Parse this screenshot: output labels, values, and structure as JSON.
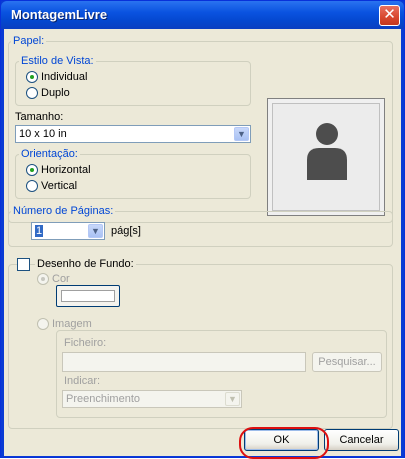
{
  "window": {
    "title": "MontagemLivre"
  },
  "papel": {
    "legend": "Papel:",
    "estilo": {
      "legend": "Estilo de Vista:",
      "options": [
        {
          "label": "Individual",
          "checked": true
        },
        {
          "label": "Duplo",
          "checked": false
        }
      ]
    },
    "tamanho": {
      "label": "Tamanho:",
      "value": "10 x 10 in"
    },
    "orientacao": {
      "legend": "Orientação:",
      "options": [
        {
          "label": "Horizontal",
          "checked": true
        },
        {
          "label": "Vertical",
          "checked": false
        }
      ]
    }
  },
  "paginas": {
    "legend": "Número de Páginas:",
    "value": "1",
    "unit": "pág[s]"
  },
  "fundo": {
    "checkbox_label": "Desenho de Fundo:",
    "checked": false,
    "cor_label": "Cor",
    "imagem_label": "Imagem",
    "ficheiro_label": "Ficheiro:",
    "ficheiro_value": "",
    "pesquisar_label": "Pesquisar...",
    "indicar_label": "Indicar:",
    "indicar_value": "Preenchimento"
  },
  "buttons": {
    "ok": "OK",
    "cancel": "Cancelar"
  },
  "colors": {
    "accent": "#0046d5",
    "highlight": "#dd1010",
    "title_bar": "#0a53e0"
  }
}
